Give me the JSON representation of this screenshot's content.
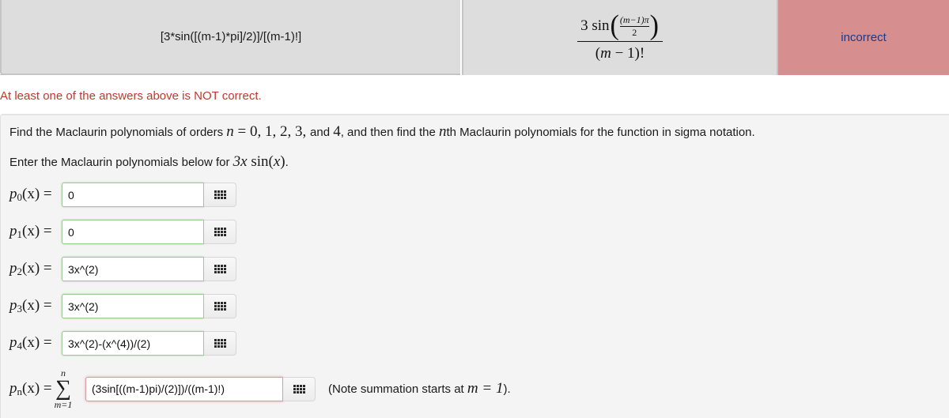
{
  "results": {
    "entered": "[3*sin([(m-1)*pi]/2)]/[(m-1)!]",
    "preview": {
      "coef": "3",
      "func": "sin",
      "inner_num": "(m−1)π",
      "inner_den": "2",
      "denominator_var": "m",
      "denominator_rest": " − 1)!",
      "denominator_open": "("
    },
    "result": "incorrect",
    "result_color": "#d68e8f"
  },
  "warning": "At least one of the answers above is NOT correct.",
  "problem": {
    "line1": {
      "pre": "Find the Maclaurin polynomials of orders ",
      "n": "n",
      "eq": " = 0, 1, 2, 3, ",
      "and": "and ",
      "four": "4",
      "mid": ", and then find the ",
      "nth_var": "n",
      "post": "th Maclaurin polynomials for the function in sigma notation."
    },
    "line2": {
      "pre": "Enter the Maclaurin polynomials below for ",
      "func": "3x sin(x)",
      "post": "."
    },
    "answers": [
      {
        "label_p": "p",
        "label_sub": "0",
        "label_rest": "(x) =",
        "value": "0",
        "status": "correct"
      },
      {
        "label_p": "p",
        "label_sub": "1",
        "label_rest": "(x) =",
        "value": "0",
        "status": "correct"
      },
      {
        "label_p": "p",
        "label_sub": "2",
        "label_rest": "(x) =",
        "value": "3x^(2)",
        "status": "correct"
      },
      {
        "label_p": "p",
        "label_sub": "3",
        "label_rest": "(x) =",
        "value": "3x^(2)",
        "status": "correct"
      },
      {
        "label_p": "p",
        "label_sub": "4",
        "label_rest": "(x) =",
        "value": "3x^(2)-(x^(4))/(2)",
        "status": "correct"
      }
    ],
    "nth": {
      "label_p": "p",
      "label_sub": "n",
      "label_rest": "(x) =",
      "sigma_upper": "n",
      "sigma_symbol": "∑",
      "sigma_lower": "m=1",
      "value": "(3sin[((m-1)pi)/(2)])/((m-1)!)",
      "status": "incorrect",
      "note_pre": "(Note summation starts at ",
      "note_math": "m = 1",
      "note_post": ")."
    }
  },
  "icons": {
    "palette": "equation-palette-grid-icon"
  }
}
